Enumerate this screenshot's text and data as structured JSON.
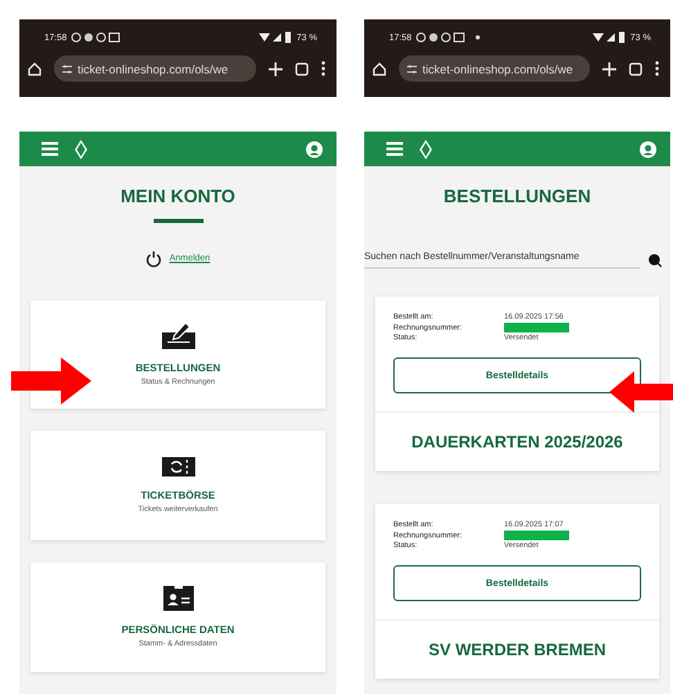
{
  "phones": [
    {
      "status_bar": {
        "time": "17:58",
        "battery": "73 %",
        "notification_dot": false
      },
      "browser": {
        "url": "ticket-onlineshop.com/ols/we"
      },
      "arrow": {
        "pointing_left": false
      },
      "page": {
        "kind": "account",
        "title": "MEIN KONTO",
        "login_link": "Anmelden",
        "cards": [
          {
            "kind": "orders",
            "title": "BESTELLUNGEN",
            "subtitle": "Status & Rechnungen"
          },
          {
            "kind": "exchange",
            "title": "TICKETBÖRSE",
            "subtitle": "Tickets weiterverkaufen"
          },
          {
            "kind": "profile",
            "title": "PERSÖNLICHE DATEN",
            "subtitle": "Stamm- & Adressdaten"
          }
        ]
      }
    },
    {
      "status_bar": {
        "time": "17:58",
        "battery": "73 %",
        "notification_dot": true
      },
      "browser": {
        "url": "ticket-onlineshop.com/ols/we"
      },
      "arrow": {
        "pointing_left": true
      },
      "page": {
        "kind": "orders",
        "title": "BESTELLUNGEN",
        "search": {
          "placeholder": "Suchen nach Bestellnummer/Veranstaltungsname"
        },
        "orders": [
          {
            "fields": [
              {
                "label": "Bestellt am:",
                "value": "16.09.2025 17:56"
              },
              {
                "label": "Rechnungsnummer:",
                "redacted": true
              },
              {
                "label": "Status:",
                "value": "Versendet"
              }
            ],
            "button": "Bestelldetails",
            "product": "DAUERKARTEN 2025/2026"
          },
          {
            "fields": [
              {
                "label": "Bestellt am:",
                "value": "16.09.2025 17:07"
              },
              {
                "label": "Rechnungsnummer:",
                "redacted": true
              },
              {
                "label": "Status:",
                "value": "Versendet"
              }
            ],
            "button": "Bestelldetails",
            "product": "SV WERDER BREMEN"
          }
        ]
      }
    }
  ]
}
